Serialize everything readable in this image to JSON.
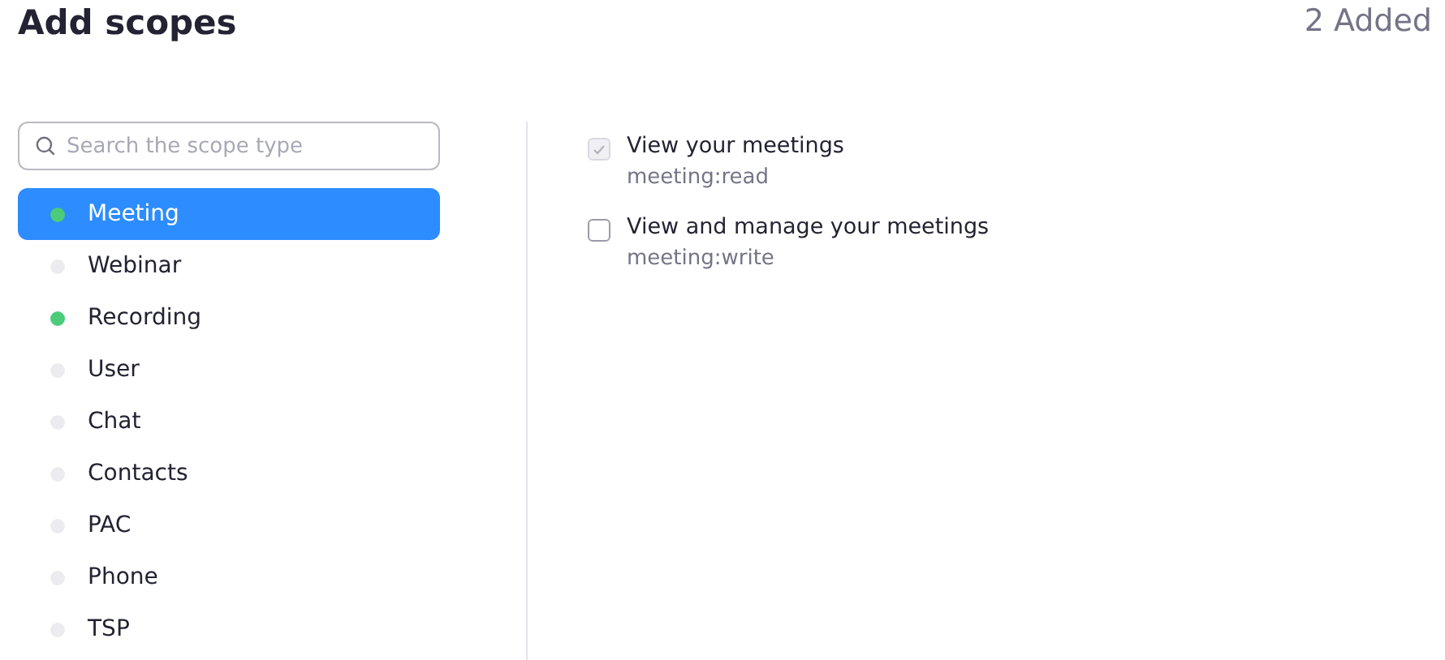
{
  "header": {
    "title": "Add scopes",
    "count": "2 Added"
  },
  "search": {
    "placeholder": "Search the scope type"
  },
  "categories": [
    {
      "label": "Meeting",
      "selected": true,
      "added": true
    },
    {
      "label": "Webinar",
      "selected": false,
      "added": false
    },
    {
      "label": "Recording",
      "selected": false,
      "added": true
    },
    {
      "label": "User",
      "selected": false,
      "added": false
    },
    {
      "label": "Chat",
      "selected": false,
      "added": false
    },
    {
      "label": "Contacts",
      "selected": false,
      "added": false
    },
    {
      "label": "PAC",
      "selected": false,
      "added": false
    },
    {
      "label": "Phone",
      "selected": false,
      "added": false
    },
    {
      "label": "TSP",
      "selected": false,
      "added": false
    }
  ],
  "scopes": [
    {
      "title": "View your meetings",
      "scope": "meeting:read",
      "checked": true,
      "disabled": true
    },
    {
      "title": "View and manage your meetings",
      "scope": "meeting:write",
      "checked": false,
      "disabled": false
    }
  ]
}
